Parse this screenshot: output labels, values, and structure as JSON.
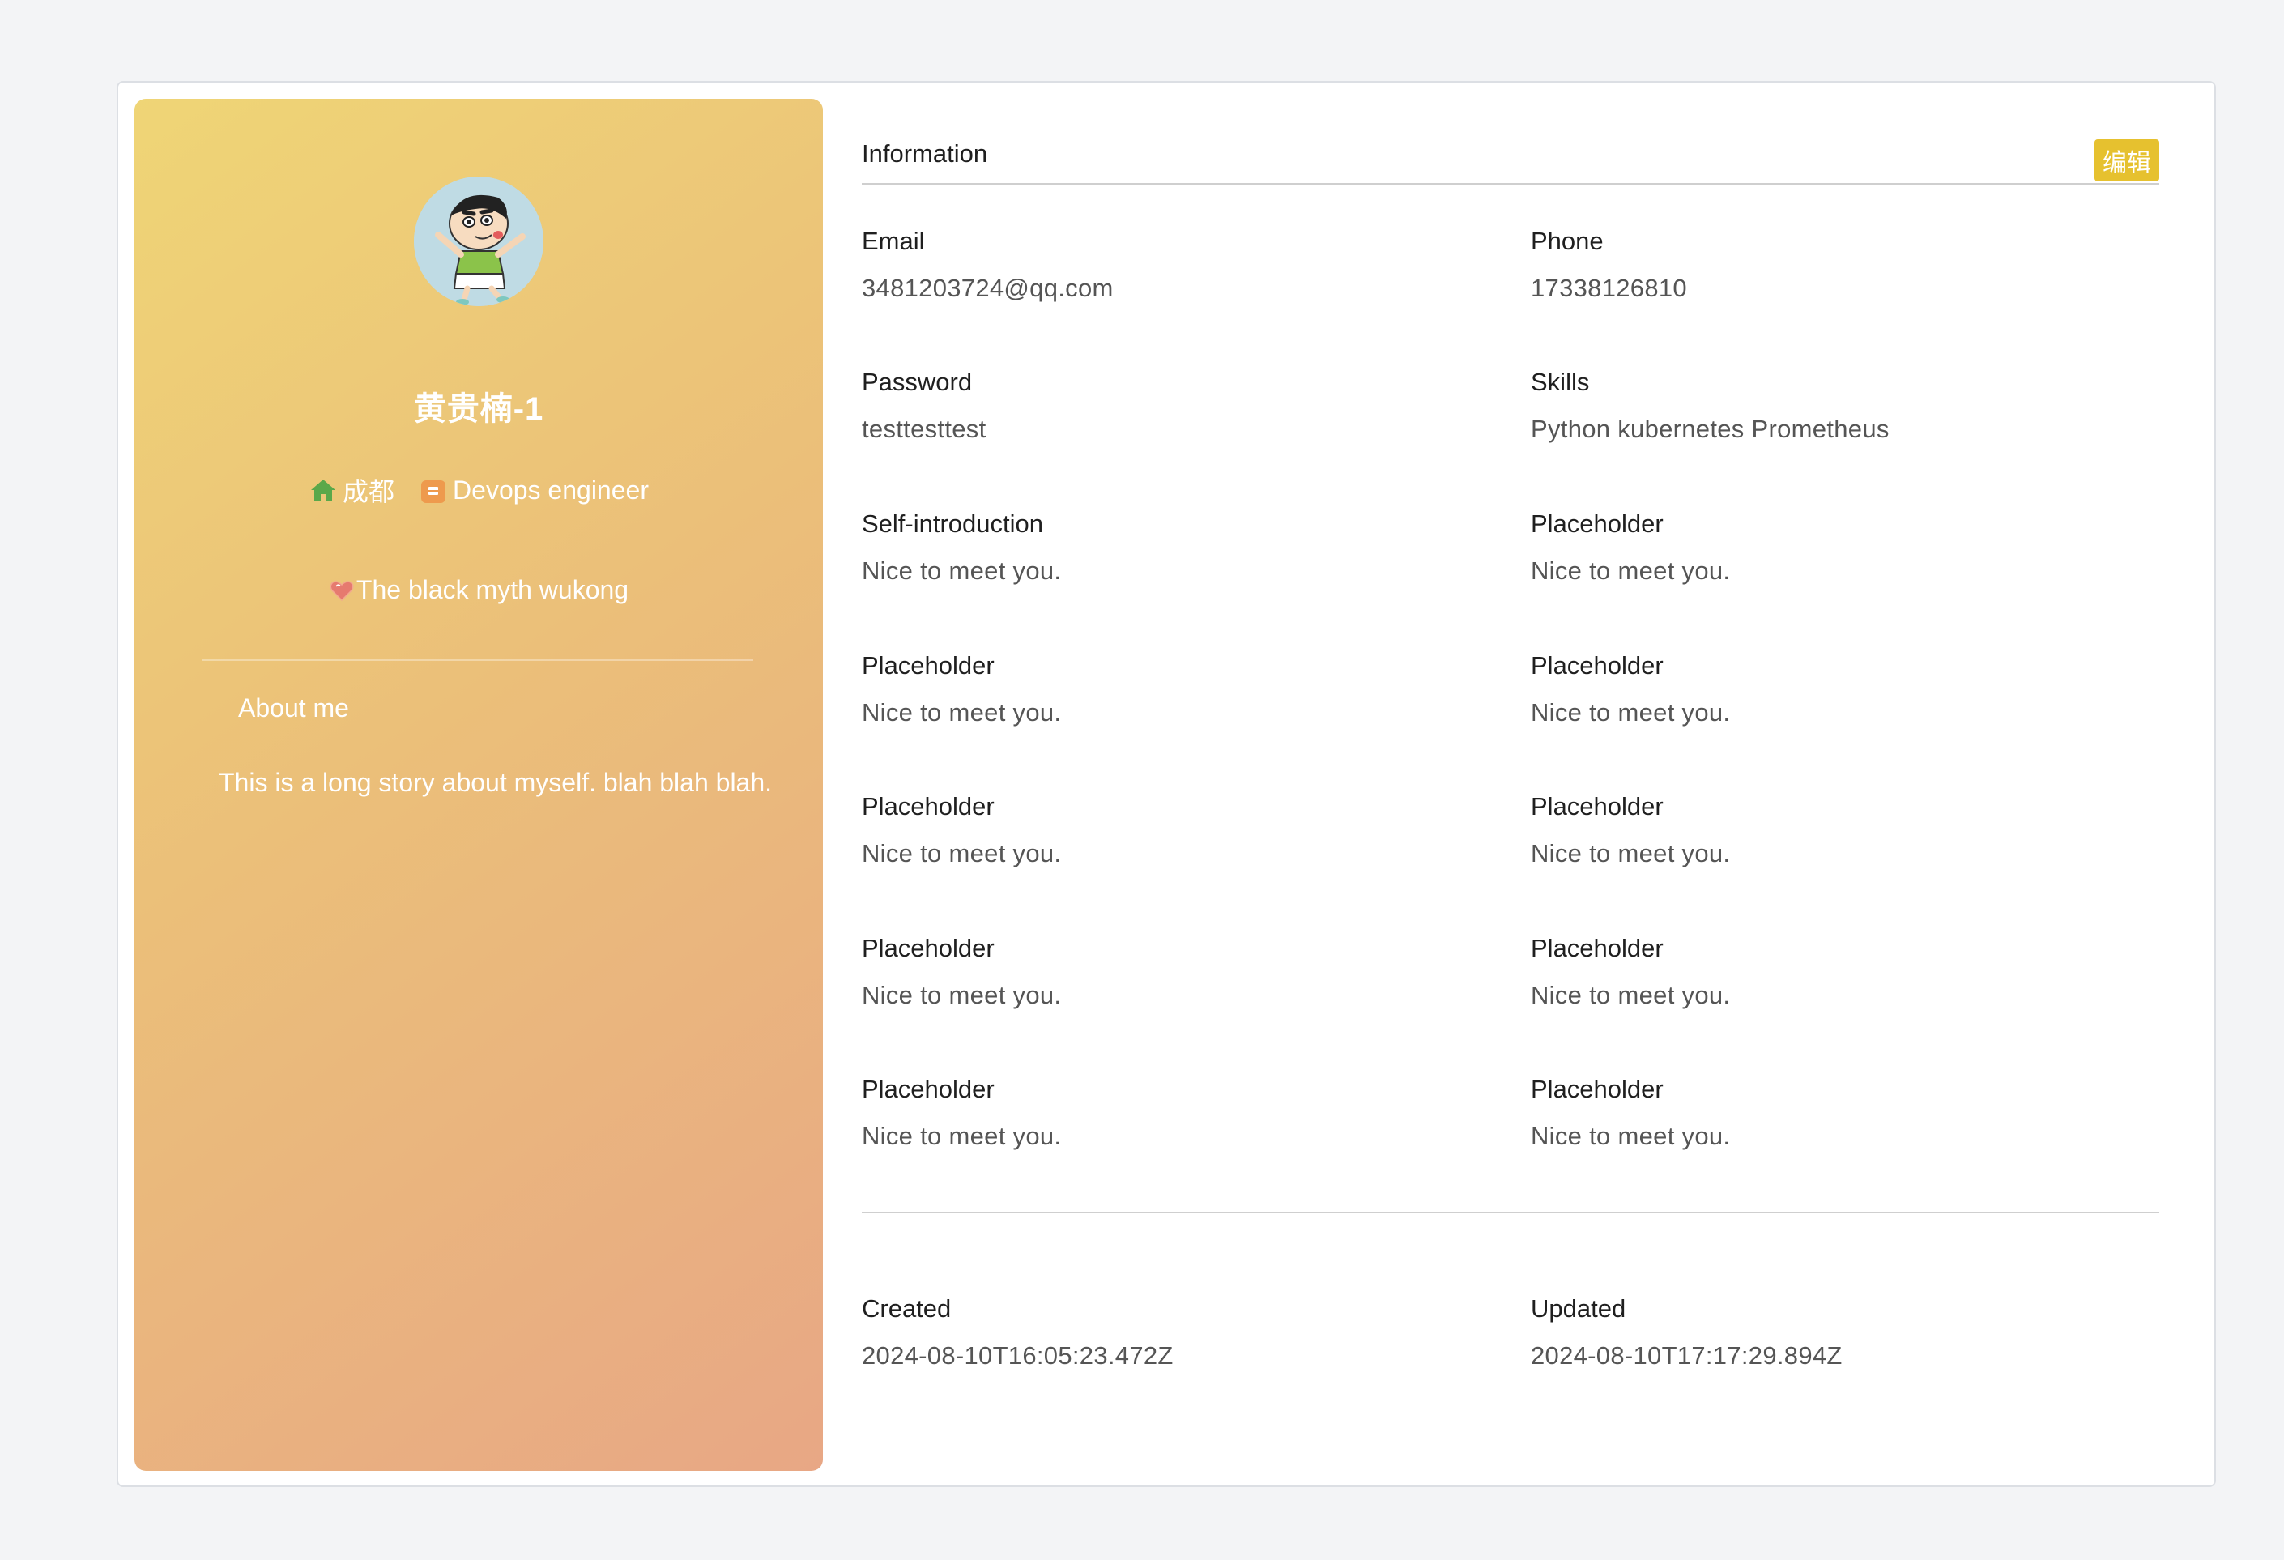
{
  "profile": {
    "name": "黄贵楠-1",
    "location": "成都",
    "job": "Devops engineer",
    "hobby": "The black myth wukong",
    "about_title": "About me",
    "about_text": "This is a long story about myself. blah blah blah."
  },
  "info": {
    "title": "Information",
    "edit_label": "编辑",
    "fields": [
      {
        "label": "Email",
        "value": "3481203724@qq.com"
      },
      {
        "label": "Phone",
        "value": "17338126810"
      },
      {
        "label": "Password",
        "value": "testtesttest"
      },
      {
        "label": "Skills",
        "value": "Python kubernetes Prometheus"
      },
      {
        "label": "Self-introduction",
        "value": "Nice to meet you."
      },
      {
        "label": "Placeholder",
        "value": "Nice to meet you."
      },
      {
        "label": "Placeholder",
        "value": "Nice to meet you."
      },
      {
        "label": "Placeholder",
        "value": "Nice to meet you."
      },
      {
        "label": "Placeholder",
        "value": "Nice to meet you."
      },
      {
        "label": "Placeholder",
        "value": "Nice to meet you."
      },
      {
        "label": "Placeholder",
        "value": "Nice to meet you."
      },
      {
        "label": "Placeholder",
        "value": "Nice to meet you."
      },
      {
        "label": "Placeholder",
        "value": "Nice to meet you."
      },
      {
        "label": "Placeholder",
        "value": "Nice to meet you."
      }
    ],
    "timestamps": [
      {
        "label": "Created",
        "value": "2024-08-10T16:05:23.472Z"
      },
      {
        "label": "Updated",
        "value": "2024-08-10T17:17:29.894Z"
      }
    ]
  },
  "icons": {
    "location": "home-icon",
    "job": "briefcase-icon",
    "hobby": "heart-icon",
    "avatar": "cartoon-avatar"
  },
  "colors": {
    "edit_button": "#e6c12f",
    "home_icon": "#5aa84a",
    "briefcase_icon": "#ee9a4d",
    "heart_icon": "#e67a6f"
  }
}
